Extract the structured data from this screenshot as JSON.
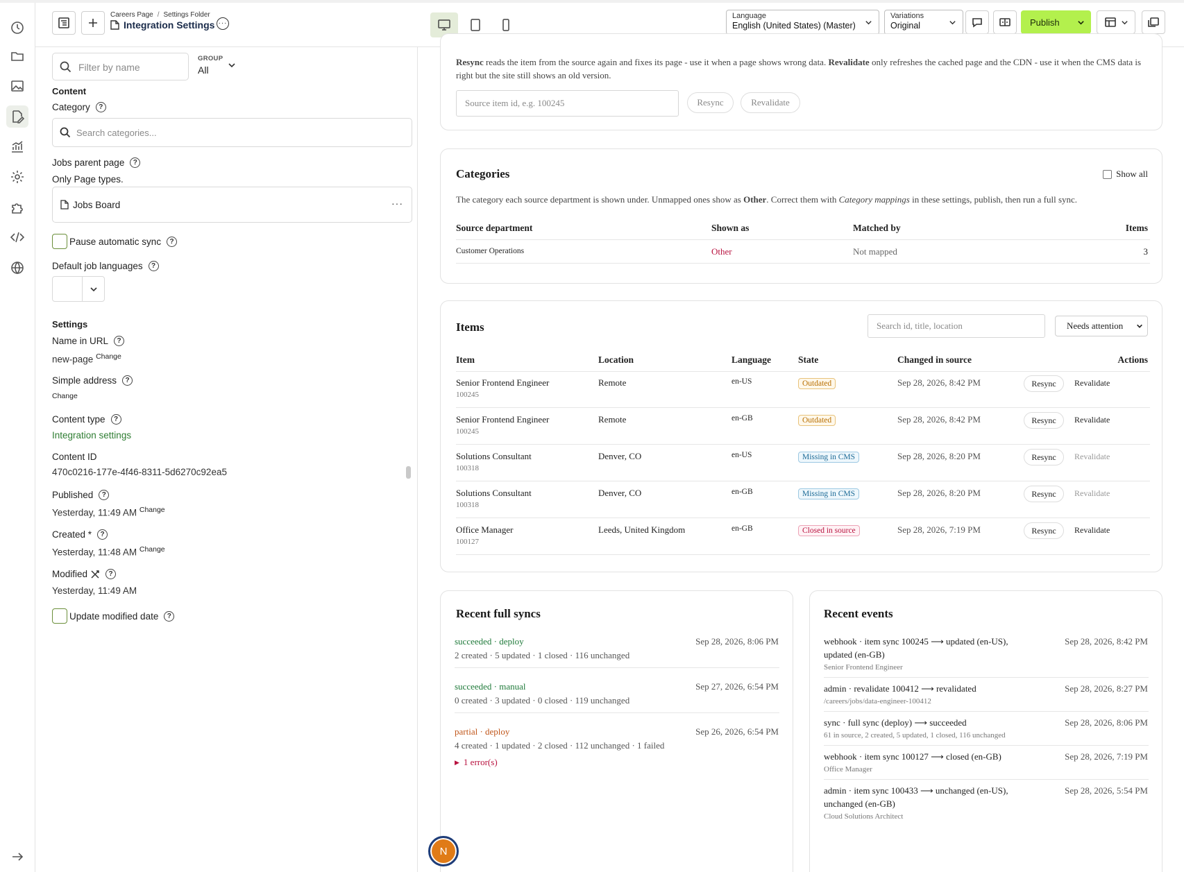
{
  "header": {
    "breadcrumb": [
      "Careers Page",
      "Settings Folder"
    ],
    "breadcrumb_sep": "/",
    "page_title": "Integration Settings",
    "language_label": "Language",
    "language_value": "English (United States) (Master)",
    "variations_label": "Variations",
    "variations_value": "Original",
    "publish_label": "Publish"
  },
  "panel": {
    "filter_placeholder": "Filter by name",
    "group_label": "GROUP",
    "group_value": "All",
    "content_heading": "Content",
    "category_label": "Category",
    "category_placeholder": "Search categories...",
    "jobs_parent_label": "Jobs parent page",
    "jobs_parent_hint": "Only Page types.",
    "jobs_parent_value": "Jobs Board",
    "pause_sync_label": "Pause automatic sync",
    "default_lang_label": "Default job languages",
    "settings_heading": "Settings",
    "name_url_label": "Name in URL",
    "name_url_value": "new-page",
    "change_label": "Change",
    "simple_address_label": "Simple address",
    "content_type_label": "Content type",
    "content_type_value": "Integration settings",
    "content_id_label": "Content ID",
    "content_id_value": "470c0216-177e-4f46-8311-5d6270c92ea5",
    "published_label": "Published",
    "published_value": "Yesterday, 11:49 AM",
    "created_label": "Created",
    "created_req": "*",
    "created_value": "Yesterday, 11:48 AM",
    "modified_label": "Modified",
    "modified_value": "Yesterday, 11:49 AM",
    "update_modified_label": "Update modified date"
  },
  "resync_card": {
    "desc_b1": "Resync",
    "desc_t1": " reads the item from the source again and fixes its page - use it when a page shows wrong data. ",
    "desc_b2": "Revalidate",
    "desc_t2": " only refreshes the cached page and the CDN - use it when the CMS data is right but the site still shows an old version.",
    "input_placeholder": "Source item id, e.g. 100245",
    "resync_btn": "Resync",
    "revalidate_btn": "Revalidate"
  },
  "categories": {
    "title": "Categories",
    "show_all": "Show all",
    "desc_t1": "The category each source department is shown under. Unmapped ones show as ",
    "desc_b1": "Other",
    "desc_t2": ". Correct them with ",
    "desc_i1": "Category mappings",
    "desc_t3": " in these settings, publish, then run a full sync.",
    "columns": [
      "Source department",
      "Shown as",
      "Matched by",
      "Items"
    ],
    "rows": [
      {
        "dept": "Customer Operations",
        "shown": "Other",
        "matched": "Not mapped",
        "items": "3"
      }
    ]
  },
  "items": {
    "title": "Items",
    "search_placeholder": "Search id, title, location",
    "filter_value": "Needs attention",
    "columns": [
      "Item",
      "Location",
      "Language",
      "State",
      "Changed in source",
      "Actions"
    ],
    "rows": [
      {
        "title": "Senior Frontend Engineer",
        "id": "100245",
        "location": "Remote",
        "lang": "en-US",
        "state": "Outdated",
        "changed": "Sep 28, 2026, 8:42 PM",
        "resync": "Resync",
        "revalidate": "Revalidate",
        "reval_enabled": true
      },
      {
        "title": "Senior Frontend Engineer",
        "id": "100245",
        "location": "Remote",
        "lang": "en-GB",
        "state": "Outdated",
        "changed": "Sep 28, 2026, 8:42 PM",
        "resync": "Resync",
        "revalidate": "Revalidate",
        "reval_enabled": true
      },
      {
        "title": "Solutions Consultant",
        "id": "100318",
        "location": "Denver, CO",
        "lang": "en-US",
        "state": "Missing in CMS",
        "changed": "Sep 28, 2026, 8:20 PM",
        "resync": "Resync",
        "revalidate": "Revalidate",
        "reval_enabled": false
      },
      {
        "title": "Solutions Consultant",
        "id": "100318",
        "location": "Denver, CO",
        "lang": "en-GB",
        "state": "Missing in CMS",
        "changed": "Sep 28, 2026, 8:20 PM",
        "resync": "Resync",
        "revalidate": "Revalidate",
        "reval_enabled": false
      },
      {
        "title": "Office Manager",
        "id": "100127",
        "location": "Leeds, United Kingdom",
        "lang": "en-GB",
        "state": "Closed in source",
        "changed": "Sep 28, 2026, 7:19 PM",
        "resync": "Resync",
        "revalidate": "Revalidate",
        "reval_enabled": true
      }
    ]
  },
  "state_colors": {
    "Outdated": {
      "fg": "#b76e00",
      "border": "#e8c27a",
      "bg": "#fff8ea"
    },
    "Missing in CMS": {
      "fg": "#1b6a96",
      "border": "#9cc8e2",
      "bg": "#eef7fc"
    },
    "Closed in source": {
      "fg": "#b8123f",
      "border": "#eca3b6",
      "bg": "#fff2f5"
    }
  },
  "syncs": {
    "title": "Recent full syncs",
    "rows": [
      {
        "status": "succeeded · deploy",
        "kind": "ok",
        "time": "Sep 28, 2026, 8:06 PM",
        "summary": "2 created · 5 updated · 1 closed · 116 unchanged"
      },
      {
        "status": "succeeded · manual",
        "kind": "ok",
        "time": "Sep 27, 2026, 6:54 PM",
        "summary": "0 created · 3 updated · 0 closed · 119 unchanged"
      },
      {
        "status": "partial · deploy",
        "kind": "partial",
        "time": "Sep 26, 2026, 6:54 PM",
        "summary": "4 created · 1 updated · 2 closed · 112 unchanged · 1 failed"
      }
    ],
    "errors_label": "1 error(s)"
  },
  "events": {
    "title": "Recent events",
    "rows": [
      {
        "line1": "webhook · item sync 100245 ⟶ updated (en-US),",
        "line2": "updated (en-GB)",
        "sub": "Senior Frontend Engineer",
        "time": "Sep 28, 2026, 8:42 PM"
      },
      {
        "line1": "admin · revalidate 100412 ⟶ revalidated",
        "line2": "",
        "sub": "/careers/jobs/data-engineer-100412",
        "time": "Sep 28, 2026, 8:27 PM"
      },
      {
        "line1": "sync · full sync (deploy) ⟶ succeeded",
        "line2": "",
        "sub": "61 in source, 2 created, 5 updated, 1 closed, 116 unchanged",
        "time": "Sep 28, 2026, 8:06 PM"
      },
      {
        "line1": "webhook · item sync 100127 ⟶ closed (en-GB)",
        "line2": "",
        "sub": "Office Manager",
        "time": "Sep 28, 2026, 7:19 PM"
      },
      {
        "line1": "admin · item sync 100433 ⟶ unchanged (en-US),",
        "line2": "unchanged (en-GB)",
        "sub": "Cloud Solutions Architect",
        "time": "Sep 28, 2026, 5:54 PM"
      }
    ]
  },
  "user": {
    "initial": "N"
  },
  "colors": {
    "accent": "#b3f04d",
    "link_green": "#2e7d32",
    "error": "#b8123f"
  }
}
